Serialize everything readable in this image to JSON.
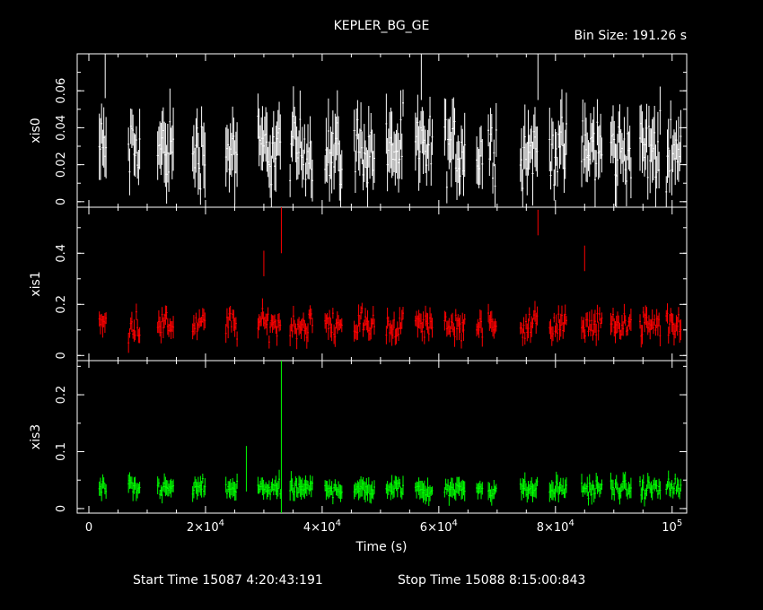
{
  "chart_data": {
    "type": "line",
    "title": "KEPLER_BG_GE",
    "bin_size_label": "Bin Size: 191.26 s",
    "xlabel": "Time (s)",
    "xlim": [
      -2000,
      102500
    ],
    "x_ticks": [
      {
        "value": 0,
        "mant": "0",
        "exp": ""
      },
      {
        "value": 20000,
        "mant": "2×10",
        "exp": "4"
      },
      {
        "value": 40000,
        "mant": "4×10",
        "exp": "4"
      },
      {
        "value": 60000,
        "mant": "6×10",
        "exp": "4"
      },
      {
        "value": 80000,
        "mant": "8×10",
        "exp": "4"
      },
      {
        "value": 100000,
        "mant": "10",
        "exp": "5"
      }
    ],
    "footer": {
      "start_label": "Start Time 15087  4:20:43:191",
      "stop_label": "Stop Time 15088  8:15:00:843"
    },
    "segments": [
      [
        1800,
        3000
      ],
      [
        6800,
        8800
      ],
      [
        11800,
        14500
      ],
      [
        17800,
        20000
      ],
      [
        23500,
        25500
      ],
      [
        29000,
        33000
      ],
      [
        34500,
        38500
      ],
      [
        40500,
        43500
      ],
      [
        45500,
        49000
      ],
      [
        51000,
        54000
      ],
      [
        56000,
        59000
      ],
      [
        61000,
        64500
      ],
      [
        66500,
        67500
      ],
      [
        68500,
        70000
      ],
      [
        74000,
        77000
      ],
      [
        79000,
        82000
      ],
      [
        84500,
        88000
      ],
      [
        89500,
        93000
      ],
      [
        94500,
        98000
      ],
      [
        99000,
        101500
      ]
    ],
    "panels": [
      {
        "name": "xis0",
        "color": "#ffffff",
        "ylim": [
          -0.003,
          0.08
        ],
        "yticks": [
          0,
          0.02,
          0.04,
          0.06
        ],
        "ytick_labels": [
          "0",
          "0.02",
          "0.04",
          "0.06"
        ],
        "median": 0.028,
        "spread": 0.016,
        "error": 0.012
      },
      {
        "name": "xis1",
        "color": "#ff0000",
        "ylim": [
          -0.02,
          0.58
        ],
        "yticks": [
          0,
          0.2,
          0.4
        ],
        "ytick_labels": [
          "0",
          "0.2",
          "0.4"
        ],
        "median": 0.12,
        "spread": 0.045,
        "error": 0.03
      },
      {
        "name": "xis3",
        "color": "#00ff00",
        "ylim": [
          -0.008,
          0.26
        ],
        "yticks": [
          0,
          0.1,
          0.2
        ],
        "ytick_labels": [
          "0",
          "0.1",
          "0.2"
        ],
        "median": 0.035,
        "spread": 0.012,
        "error": 0.012
      }
    ],
    "spikes": [
      {
        "panel": 1,
        "x": 33000,
        "y": 0.5,
        "error": 0.1
      },
      {
        "panel": 1,
        "x": 77000,
        "y": 0.52,
        "error": 0.05
      },
      {
        "panel": 1,
        "x": 30000,
        "y": 0.36,
        "error": 0.05
      },
      {
        "panel": 1,
        "x": 85000,
        "y": 0.38,
        "error": 0.05
      },
      {
        "panel": 2,
        "x": 33000,
        "y": 0.26,
        "error": 0.0
      },
      {
        "panel": 2,
        "x": 27000,
        "y": 0.07,
        "error": 0.04
      },
      {
        "panel": 0,
        "x": 2800,
        "y": 0.068,
        "error": 0.012
      },
      {
        "panel": 0,
        "x": 57000,
        "y": 0.07,
        "error": 0.015
      },
      {
        "panel": 0,
        "x": 77000,
        "y": 0.07,
        "error": 0.015
      }
    ]
  }
}
